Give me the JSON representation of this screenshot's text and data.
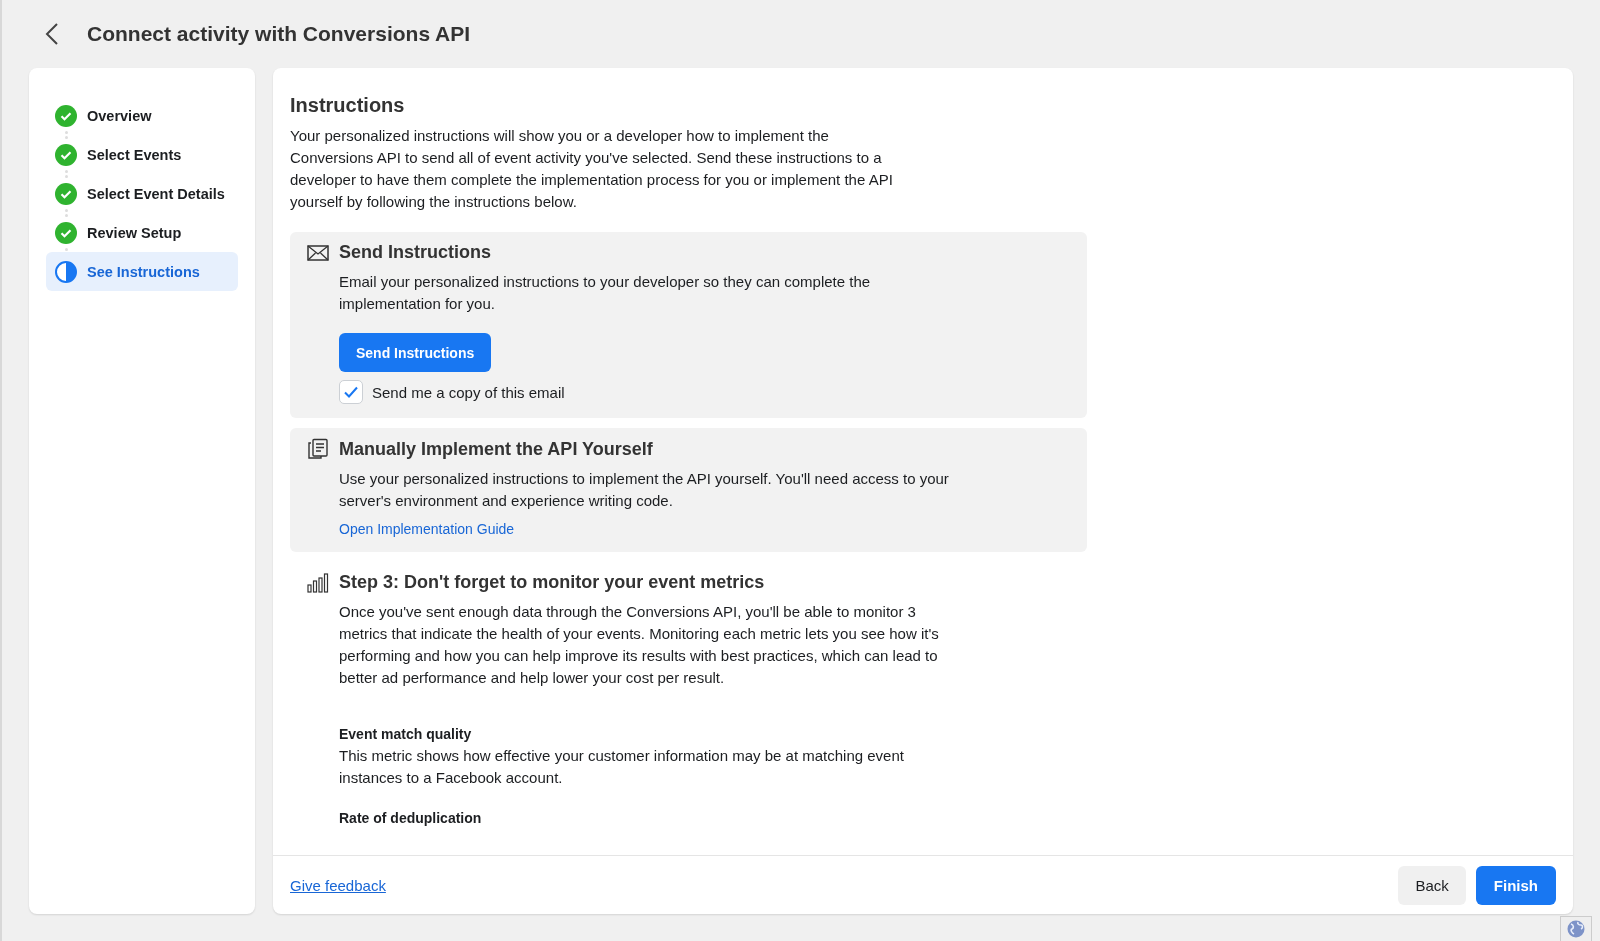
{
  "header": {
    "title": "Connect activity with Conversions API"
  },
  "steps": [
    {
      "label": "Overview",
      "kind": "complete",
      "selected": false
    },
    {
      "label": "Select Events",
      "kind": "complete",
      "selected": false
    },
    {
      "label": "Select Event Details",
      "kind": "complete",
      "selected": false
    },
    {
      "label": "Review Setup",
      "kind": "complete",
      "selected": false
    },
    {
      "label": "See Instructions",
      "kind": "current",
      "selected": true
    }
  ],
  "content": {
    "title": "Instructions",
    "intro": "Your personalized instructions will show you or a developer how to implement the Conversions API to send all of event activity you've selected. Send these instructions to a developer to have them complete the implementation process for you or implement the API yourself by following the instructions below.",
    "sections": [
      {
        "kind": "email",
        "title": "Send Instructions",
        "text": "Email your personalized instructions to your developer so they can complete the implementation for you.",
        "button": "Send Instructions",
        "checkbox": {
          "label": "Send me a copy of this email",
          "checked": true
        }
      },
      {
        "kind": "manual",
        "title": "Manually Implement the API Yourself",
        "text": "Use your personalized instructions to implement the API yourself. You'll need access to your server's environment and experience writing code.",
        "link": "Open Implementation Guide"
      },
      {
        "kind": "metrics",
        "title": "Step 3: Don't forget to monitor your event metrics",
        "text": "Once you've sent enough data through the Conversions API, you'll be able to monitor 3 metrics that indicate the health of your events. Monitoring each metric lets you see how it's performing and how you can help improve its results with best practices, which can lead to better ad performance and help lower your cost per result.",
        "metrics": [
          {
            "name": "Event match quality",
            "text": "This metric shows how effective your customer information may be at matching event instances to a Facebook account."
          },
          {
            "name": "Rate of deduplication"
          }
        ]
      }
    ]
  },
  "footer": {
    "feedback_link": "Give feedback",
    "buttons": [
      {
        "label": "Back",
        "kind": "secondary"
      },
      {
        "label": "Finish",
        "kind": "primary"
      }
    ]
  }
}
